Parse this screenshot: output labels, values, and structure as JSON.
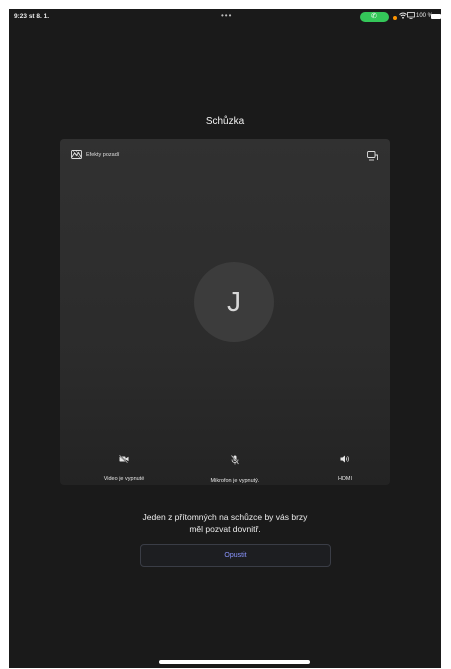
{
  "status_bar": {
    "time": "9:23  st 8. 1.",
    "dots": "•••",
    "call_icon": "phone-icon",
    "battery_text": "100 %",
    "call_color": "#34c759",
    "mic_indicator_color": "#ff9500"
  },
  "title": "Schůzka",
  "preview": {
    "effects_label": "Efekty pozadí",
    "effects_icon": "background-effects-icon",
    "switch_icon": "switch-camera-icon",
    "avatar_initial": "J",
    "controls": [
      {
        "icon": "video-off-icon",
        "label": "Video je vypnuté"
      },
      {
        "icon": "mic-off-icon",
        "label": "Mikrofon je vypnutý."
      },
      {
        "icon": "speaker-icon",
        "label": "HDMI"
      }
    ]
  },
  "message": {
    "line1": "Jeden z přítomných na schůzce by vás brzy",
    "line2": "měl pozvat dovnitř."
  },
  "leave_label": "Opustit",
  "colors": {
    "background": "#1a1a1a",
    "accent": "#8a95ff"
  }
}
